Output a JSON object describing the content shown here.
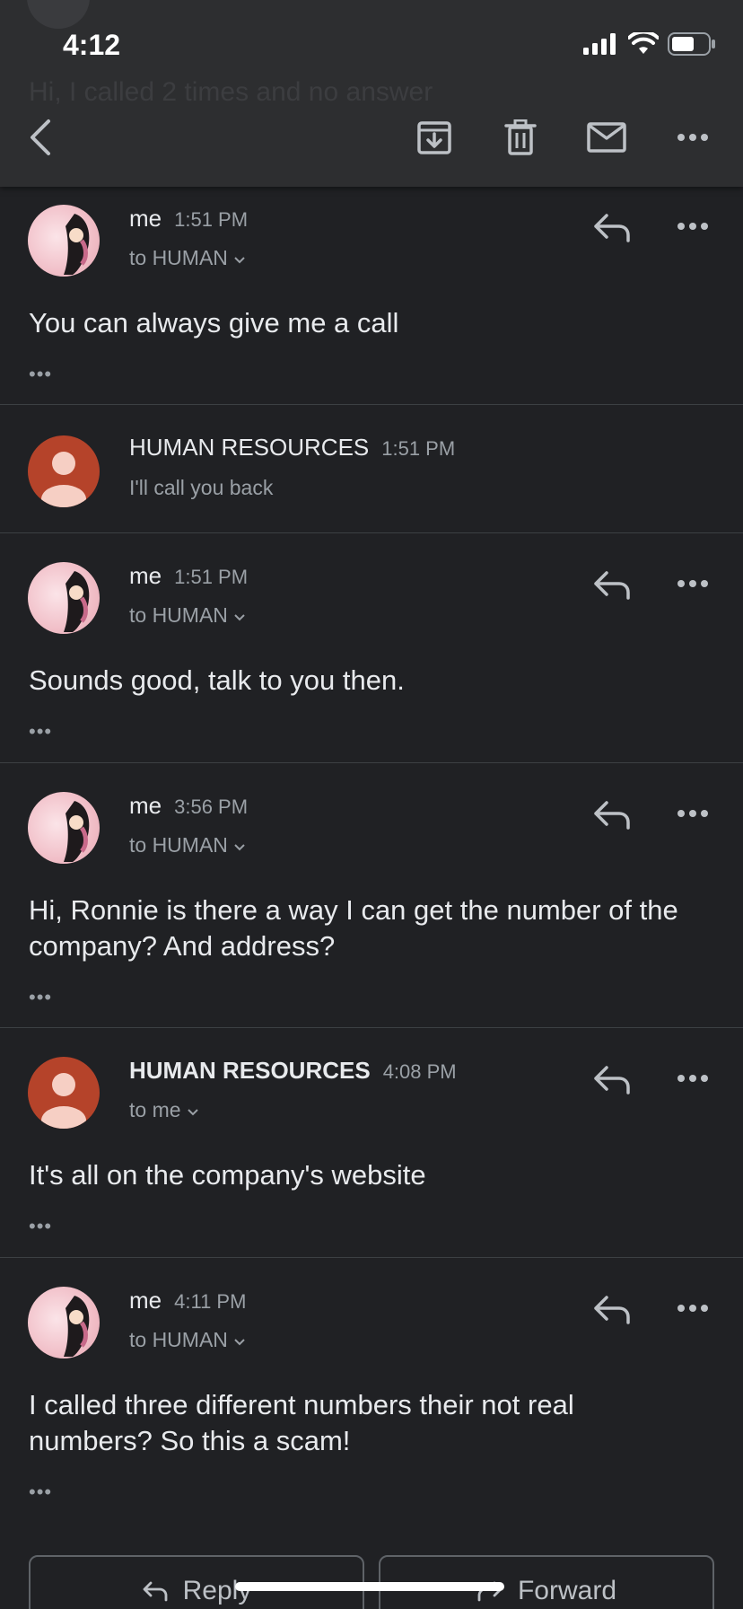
{
  "status": {
    "time": "4:12"
  },
  "header": {
    "faded_subject": "Hi, I called 2 times and no answer"
  },
  "messages": [
    {
      "sender": "me",
      "time": "1:51 PM",
      "recipient": "to HUMAN",
      "body": "You can always give me a call",
      "dots": "•••"
    },
    {
      "sender": "HUMAN RESOURCES",
      "time": "1:51 PM",
      "snippet": "I'll call you back"
    },
    {
      "sender": "me",
      "time": "1:51 PM",
      "recipient": "to HUMAN",
      "body": "Sounds good, talk to you then.",
      "dots": "•••"
    },
    {
      "sender": "me",
      "time": "3:56 PM",
      "recipient": "to HUMAN",
      "body": "Hi, Ronnie is there a way I can get the number of the company? And address?",
      "dots": "•••"
    },
    {
      "sender": "HUMAN RESOURCES",
      "time": "4:08 PM",
      "recipient": "to me",
      "body": "It's all on the company's website",
      "dots": "•••"
    },
    {
      "sender": "me",
      "time": "4:11 PM",
      "recipient": "to HUMAN",
      "body": "I called three different numbers their not real numbers? So this a scam!",
      "dots": "•••"
    }
  ],
  "actions": {
    "reply": "Reply",
    "forward": "Forward"
  },
  "colors": {
    "background": "#202124",
    "toolbar": "#2d2e30",
    "hr_avatar": "#b5432a",
    "text_secondary": "#9aa0a6"
  }
}
